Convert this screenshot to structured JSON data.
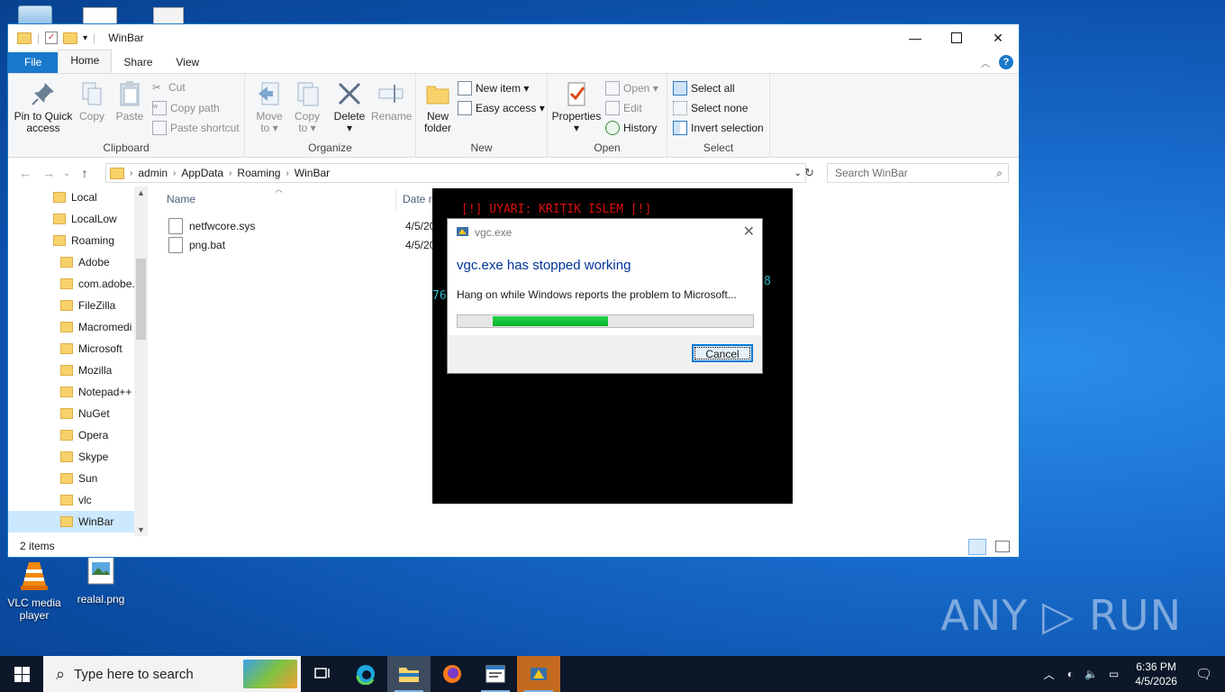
{
  "desktop": {
    "icons": [
      {
        "label": "VLC media\nplayer",
        "line1": "VLC media",
        "line2": "player"
      },
      {
        "label": "realal.png"
      }
    ],
    "watermark": "ANY ▷ RUN"
  },
  "explorer": {
    "title": "WinBar",
    "tabs": {
      "file": "File",
      "home": "Home",
      "share": "Share",
      "view": "View"
    },
    "ribbon": {
      "clipboard": {
        "label": "Clipboard",
        "pin": [
          "Pin to Quick",
          "access"
        ],
        "copy": "Copy",
        "paste": "Paste",
        "cut": "Cut",
        "copy_path": "Copy path",
        "paste_shortcut": "Paste shortcut"
      },
      "organize": {
        "label": "Organize",
        "move_to": [
          "Move",
          "to ▾"
        ],
        "copy_to": [
          "Copy",
          "to ▾"
        ],
        "delete": [
          "Delete",
          "▾"
        ],
        "rename": "Rename"
      },
      "new": {
        "label": "New",
        "new_folder": [
          "New",
          "folder"
        ],
        "new_item": "New item ▾",
        "easy_access": "Easy access ▾"
      },
      "open": {
        "label": "Open",
        "properties": [
          "Properties",
          "▾"
        ],
        "open": "Open ▾",
        "edit": "Edit",
        "history": "History"
      },
      "select": {
        "label": "Select",
        "select_all": "Select all",
        "select_none": "Select none",
        "invert": "Invert selection"
      }
    },
    "address": {
      "crumbs": [
        "admin",
        "AppData",
        "Roaming",
        "WinBar"
      ],
      "search_placeholder": "Search WinBar"
    },
    "nav_items": [
      "Local",
      "LocalLow",
      "Roaming",
      "Adobe",
      "com.adobe.",
      "FileZilla",
      "Macromedi",
      "Microsoft",
      "Mozilla",
      "Notepad++",
      "NuGet",
      "Opera",
      "Skype",
      "Sun",
      "vlc",
      "WinBar"
    ],
    "columns": {
      "name": "Name",
      "date": "Date m"
    },
    "files": [
      {
        "name": "netfwcore.sys",
        "date": "4/5/20"
      },
      {
        "name": "png.bat",
        "date": "4/5/20"
      }
    ],
    "status": "2 items"
  },
  "console": {
    "line1": "[!] UYARI: KRITIK ISLEM [!]",
    "left_frag": "76",
    "right_frag": "8"
  },
  "dialog": {
    "title": "vgc.exe",
    "heading": "vgc.exe has stopped working",
    "message": "Hang on while Windows reports the problem to Microsoft...",
    "cancel": "Cancel",
    "progress_start": 0.12,
    "progress_end": 0.51
  },
  "taskbar": {
    "search_placeholder": "Type here to search",
    "time": "6:36 PM",
    "date": "4/5/2026"
  },
  "colors": {
    "accent": "#1979ca",
    "console_red": "#e01010",
    "console_cyan": "#2fc7d6",
    "progress_green": "#06b025"
  }
}
